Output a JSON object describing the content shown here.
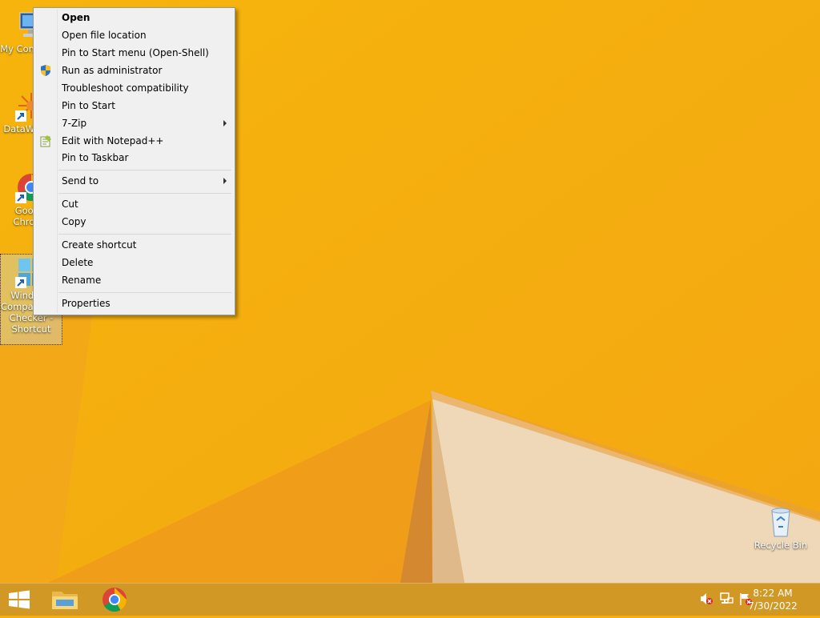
{
  "desktop_icons": [
    {
      "label": "My Computer"
    },
    {
      "label": "DataWarrior"
    },
    {
      "label": "Google Chrome"
    },
    {
      "label": "Windows Compatibility Checker - Shortcut"
    },
    {
      "label": "Recycle Bin"
    }
  ],
  "context_menu": {
    "items": [
      {
        "label": "Open"
      },
      {
        "label": "Open file location"
      },
      {
        "label": "Pin to Start menu (Open-Shell)"
      },
      {
        "label": "Run as administrator"
      },
      {
        "label": "Troubleshoot compatibility"
      },
      {
        "label": "Pin to Start"
      },
      {
        "label": "7-Zip"
      },
      {
        "label": "Edit with Notepad++"
      },
      {
        "label": "Pin to Taskbar"
      },
      {
        "label": "Send to"
      },
      {
        "label": "Cut"
      },
      {
        "label": "Copy"
      },
      {
        "label": "Create shortcut"
      },
      {
        "label": "Delete"
      },
      {
        "label": "Rename"
      },
      {
        "label": "Properties"
      }
    ]
  },
  "taskbar": {
    "clock_time": "8:22 AM",
    "clock_date": "7/30/2022"
  },
  "colors": {
    "wallpaper": "#f5b10a",
    "menu_bg": "#f0f0f0",
    "taskbar": "#cd9628"
  }
}
